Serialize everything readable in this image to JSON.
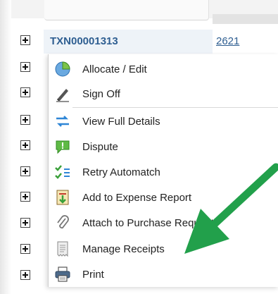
{
  "grid": {
    "transaction_id": "TXN00001313",
    "reference_number": "2621"
  },
  "menu": {
    "items": [
      {
        "label": "Allocate / Edit",
        "icon": "pie-chart-icon"
      },
      {
        "label": "Sign Off",
        "icon": "pen-icon"
      },
      {
        "label": "View Full Details",
        "icon": "swap-arrows-icon"
      },
      {
        "label": "Dispute",
        "icon": "speech-bubble-alert-icon"
      },
      {
        "label": "Retry Automatch",
        "icon": "checklist-icon"
      },
      {
        "label": "Add to Expense Report",
        "icon": "document-add-icon"
      },
      {
        "label": "Attach to Purchase Request",
        "icon": "paperclip-icon"
      },
      {
        "label": "Manage Receipts",
        "icon": "receipt-icon"
      },
      {
        "label": "Print",
        "icon": "printer-icon"
      }
    ]
  },
  "colors": {
    "link": "#2e5e91",
    "annotation_arrow": "#22a04b"
  }
}
